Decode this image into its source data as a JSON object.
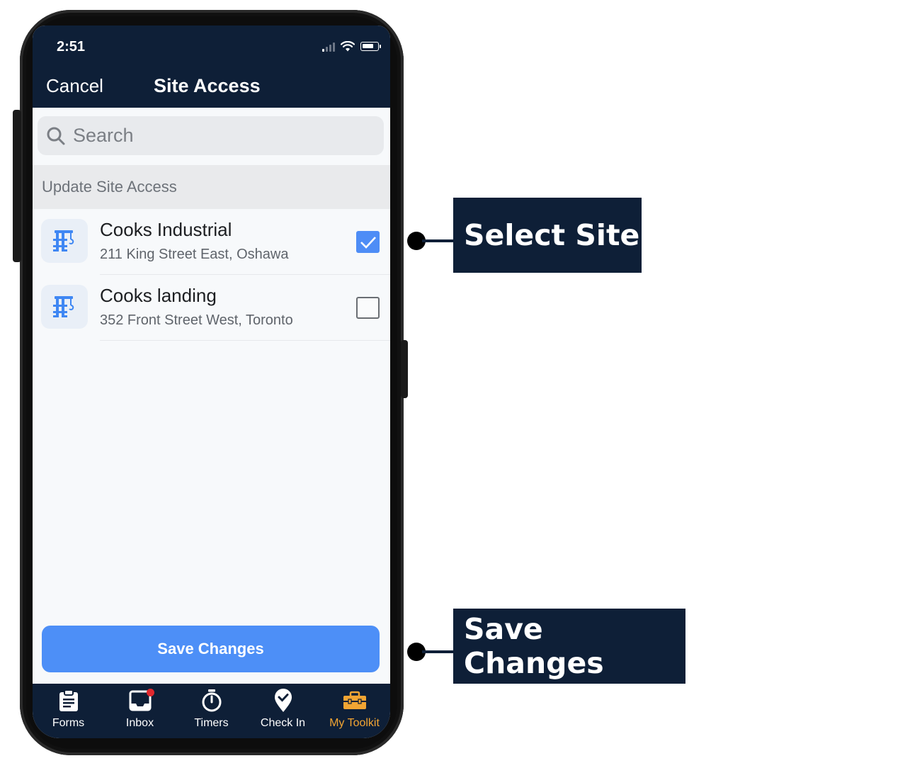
{
  "status_bar": {
    "time": "2:51"
  },
  "header": {
    "cancel_label": "Cancel",
    "title": "Site Access"
  },
  "search": {
    "placeholder": "Search"
  },
  "section": {
    "label": "Update Site Access"
  },
  "sites": [
    {
      "name": "Cooks Industrial",
      "address": "211 King Street East, Oshawa",
      "checked": true
    },
    {
      "name": "Cooks landing",
      "address": "352 Front Street West, Toronto",
      "checked": false
    }
  ],
  "save_label": "Save Changes",
  "tabs": [
    {
      "label": "Forms",
      "icon": "clipboard-icon"
    },
    {
      "label": "Inbox",
      "icon": "inbox-icon"
    },
    {
      "label": "Timers",
      "icon": "stopwatch-icon"
    },
    {
      "label": "Check In",
      "icon": "location-check-icon"
    },
    {
      "label": "My Toolkit",
      "icon": "toolbox-icon",
      "active": true
    }
  ],
  "callouts": {
    "select_site": "Select Site",
    "save_changes": "Save Changes"
  },
  "colors": {
    "navy": "#0e1f37",
    "accent_blue": "#4d8ff7",
    "active_tab": "#f2a533",
    "badge_red": "#e0282e"
  }
}
